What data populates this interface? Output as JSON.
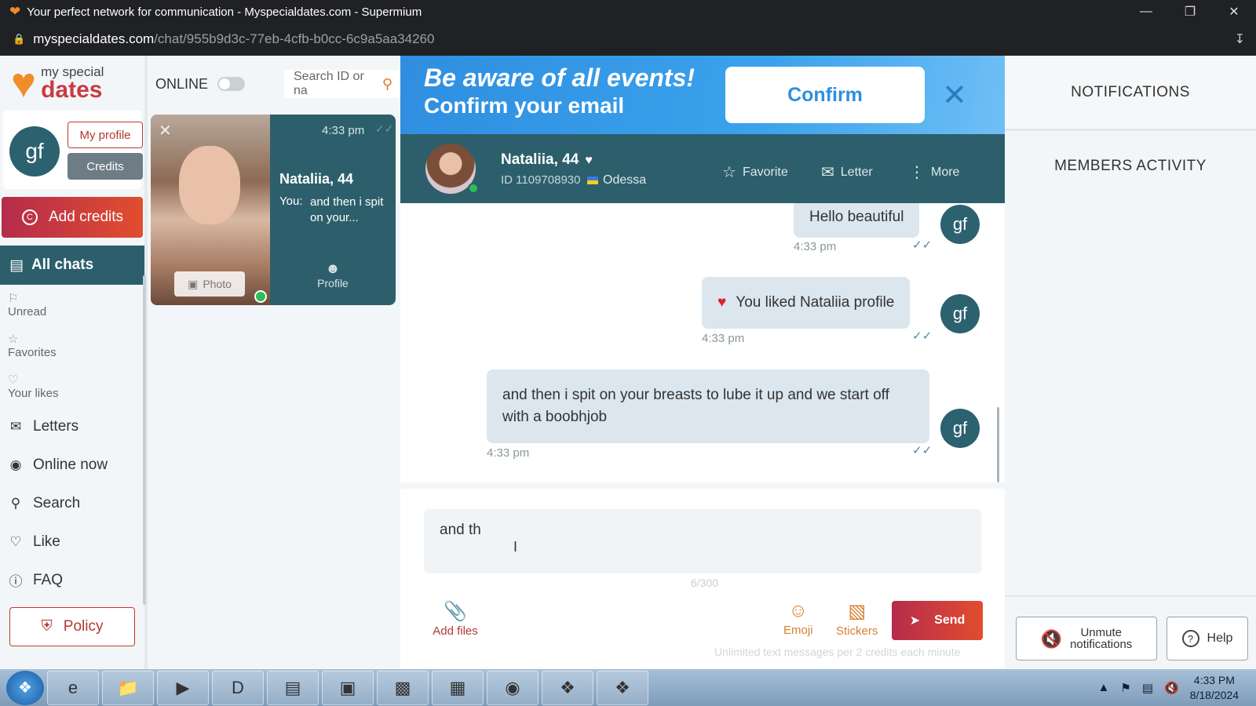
{
  "window": {
    "title": "Your perfect network for communication - Myspecialdates.com - Supermium",
    "url_host": "myspecialdates.com",
    "url_path": "/chat/955b9d3c-77eb-4cfb-b0cc-6c9a5aa34260"
  },
  "sidebar": {
    "logo_line1": "my special",
    "logo_line2": "dates",
    "avatar_initials": "gf",
    "my_profile_label": "My profile",
    "credits_label": "Credits",
    "add_credits_label": "Add credits",
    "all_chats_label": "All chats",
    "sub_items": [
      {
        "label": "Unread",
        "icon": "flag-icon"
      },
      {
        "label": "Favorites",
        "icon": "star-icon"
      },
      {
        "label": "Your likes",
        "icon": "heart-icon"
      }
    ],
    "nav_items": [
      {
        "label": "Letters",
        "icon": "envelope-icon"
      },
      {
        "label": "Online now",
        "icon": "toggle-icon"
      },
      {
        "label": "Search",
        "icon": "search-icon"
      },
      {
        "label": "Like",
        "icon": "heart-plus-icon"
      },
      {
        "label": "FAQ",
        "icon": "question-icon"
      }
    ],
    "policy_label": "Policy"
  },
  "chatlist": {
    "online_label": "ONLINE",
    "search_placeholder": "Search ID or na",
    "card": {
      "time": "4:33 pm",
      "name": "Nataliia, 44",
      "you_label": "You:",
      "preview": "and then i spit on your...",
      "photo_label": "Photo",
      "profile_label": "Profile"
    }
  },
  "banner": {
    "line1": "Be aware of all events!",
    "line2": "Confirm your email",
    "confirm_label": "Confirm"
  },
  "chat_header": {
    "name": "Nataliia, 44",
    "id": "ID 1109708930",
    "city": "Odessa",
    "favorite_label": "Favorite",
    "letter_label": "Letter",
    "more_label": "More"
  },
  "messages": [
    {
      "text": "Hello beautiful",
      "time": "4:33 pm",
      "sender": "gf"
    },
    {
      "text": "You liked Nataliia profile",
      "time": "4:33 pm",
      "sender": "gf"
    },
    {
      "text": "and then i spit on your breasts to lube it up and we start off with a boobhjob",
      "time": "4:33 pm",
      "sender": "gf"
    }
  ],
  "composer": {
    "typed_text": "and th",
    "counter": "6/300",
    "add_files_label": "Add files",
    "emoji_label": "Emoji",
    "stickers_label": "Stickers",
    "send_label": "Send",
    "footnote": "Unlimited text messages per 2 credits each minute"
  },
  "right_panel": {
    "notifications_title": "NOTIFICATIONS",
    "members_title": "MEMBERS ACTIVITY",
    "unmute_label_1": "Unmute",
    "unmute_label_2": "notifications",
    "help_label": "Help"
  },
  "taskbar": {
    "time": "4:33 PM",
    "date": "8/18/2024"
  },
  "colors": {
    "brand_orange": "#f28c28",
    "brand_red": "#c93a43",
    "teal": "#2c5f6b",
    "banner_blue": "#2f8ee0"
  }
}
